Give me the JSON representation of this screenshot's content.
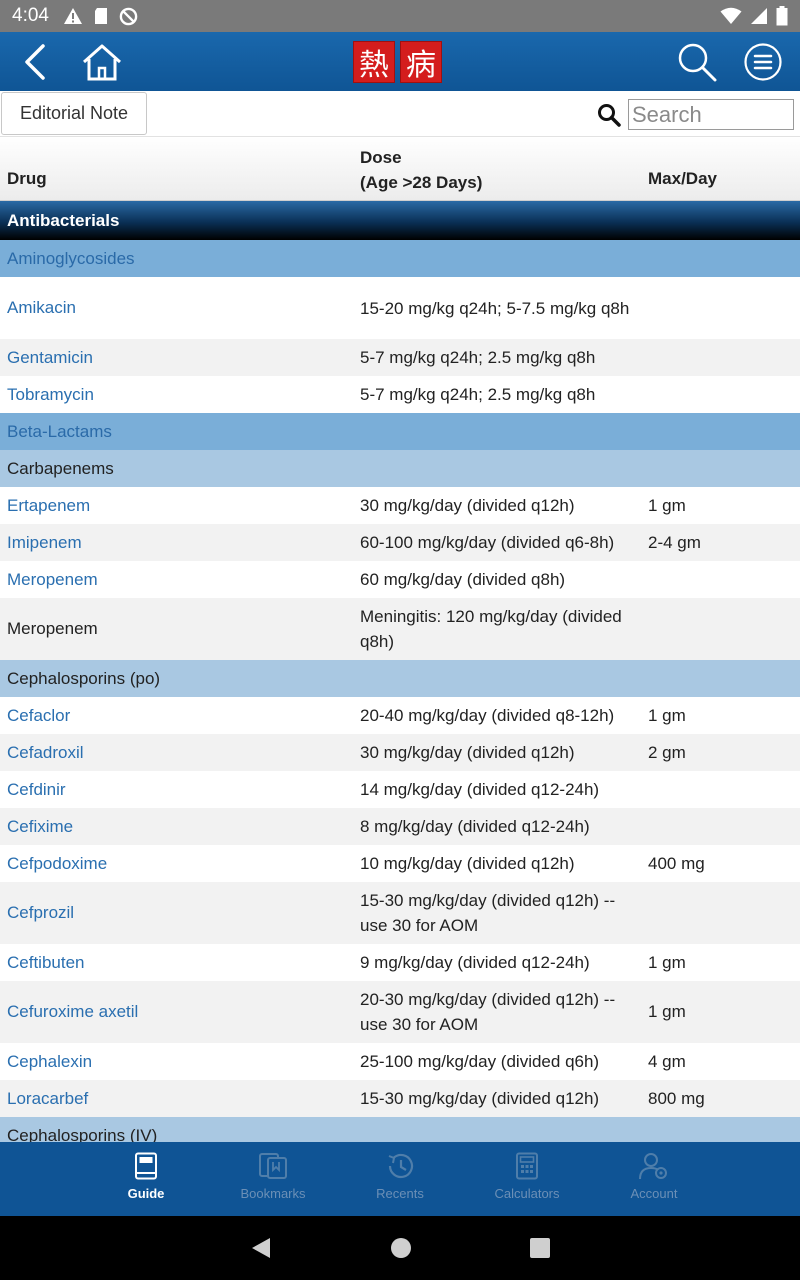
{
  "status_bar": {
    "time": "4:04"
  },
  "header": {
    "logo_chars": [
      "熱",
      "病"
    ]
  },
  "toolbar": {
    "editorial_note_label": "Editorial Note",
    "search_placeholder": "Search"
  },
  "table": {
    "headers": {
      "drug": "Drug",
      "dose_line1": "Dose",
      "dose_line2": "(Age >28 Days)",
      "max": "Max/Day"
    },
    "rows": [
      {
        "kind": "section",
        "label": "Antibacterials"
      },
      {
        "kind": "subsection",
        "label": "Aminoglycosides"
      },
      {
        "kind": "drug",
        "drug": "Amikacin",
        "link": true,
        "dose": "15-20 mg/kg q24h; 5-7.5 mg/kg q8h",
        "max": "",
        "tall": true
      },
      {
        "kind": "drug",
        "drug": "Gentamicin",
        "link": true,
        "dose": "5-7 mg/kg q24h; 2.5 mg/kg q8h",
        "max": ""
      },
      {
        "kind": "drug",
        "drug": "Tobramycin",
        "link": true,
        "dose": "5-7 mg/kg q24h; 2.5 mg/kg q8h",
        "max": ""
      },
      {
        "kind": "subsection",
        "label": "Beta-Lactams"
      },
      {
        "kind": "group",
        "label": "Carbapenems"
      },
      {
        "kind": "drug",
        "drug": "Ertapenem",
        "link": true,
        "dose": "30 mg/kg/day (divided q12h)",
        "max": "1 gm"
      },
      {
        "kind": "drug",
        "drug": "Imipenem",
        "link": true,
        "dose": "60-100 mg/kg/day (divided q6-8h)",
        "max": "2-4 gm"
      },
      {
        "kind": "drug",
        "drug": "Meropenem",
        "link": true,
        "dose": "60 mg/kg/day (divided q8h)",
        "max": ""
      },
      {
        "kind": "drug",
        "drug": "Meropenem",
        "link": false,
        "dose": "Meningitis: 120 mg/kg/day (divided q8h)",
        "max": "",
        "tall": true
      },
      {
        "kind": "group",
        "label": "Cephalosporins (po)"
      },
      {
        "kind": "drug",
        "drug": "Cefaclor",
        "link": true,
        "dose": "20-40 mg/kg/day (divided q8-12h)",
        "max": "1 gm"
      },
      {
        "kind": "drug",
        "drug": "Cefadroxil",
        "link": true,
        "dose": "30 mg/kg/day (divided q12h)",
        "max": "2 gm"
      },
      {
        "kind": "drug",
        "drug": "Cefdinir",
        "link": true,
        "dose": "14 mg/kg/day (divided q12-24h)",
        "max": ""
      },
      {
        "kind": "drug",
        "drug": "Cefixime",
        "link": true,
        "dose": "8 mg/kg/day (divided q12-24h)",
        "max": ""
      },
      {
        "kind": "drug",
        "drug": "Cefpodoxime",
        "link": true,
        "dose": "10 mg/kg/day (divided q12h)",
        "max": "400 mg"
      },
      {
        "kind": "drug",
        "drug": "Cefprozil",
        "link": true,
        "dose": "15-30 mg/kg/day (divided q12h) -- use 30 for AOM",
        "max": "",
        "tall": true
      },
      {
        "kind": "drug",
        "drug": "Ceftibuten",
        "link": true,
        "dose": "9 mg/kg/day (divided q12-24h)",
        "max": "1 gm"
      },
      {
        "kind": "drug",
        "drug": "Cefuroxime axetil",
        "link": true,
        "dose": "20-30 mg/kg/day (divided q12h) -- use 30 for AOM",
        "max": "1 gm",
        "tall": true
      },
      {
        "kind": "drug",
        "drug": "Cephalexin",
        "link": true,
        "dose": "25-100 mg/kg/day (divided q6h)",
        "max": "4 gm"
      },
      {
        "kind": "drug",
        "drug": "Loracarbef",
        "link": true,
        "dose": "15-30 mg/kg/day (divided q12h)",
        "max": "800 mg"
      },
      {
        "kind": "group",
        "label": "Cephalosporins (IV)"
      }
    ]
  },
  "bottom_nav": {
    "items": [
      {
        "label": "Guide",
        "icon": "book-icon",
        "active": true
      },
      {
        "label": "Bookmarks",
        "icon": "bookmarks-icon",
        "active": false
      },
      {
        "label": "Recents",
        "icon": "history-clock-icon",
        "active": false
      },
      {
        "label": "Calculators",
        "icon": "calculator-icon",
        "active": false
      },
      {
        "label": "Account",
        "icon": "account-gear-icon",
        "active": false
      }
    ]
  },
  "colors": {
    "header_blue": "#0f5595",
    "link_blue": "#2a6fb0",
    "subsection_bg": "#7aaed8",
    "group_bg": "#a9c8e2"
  }
}
